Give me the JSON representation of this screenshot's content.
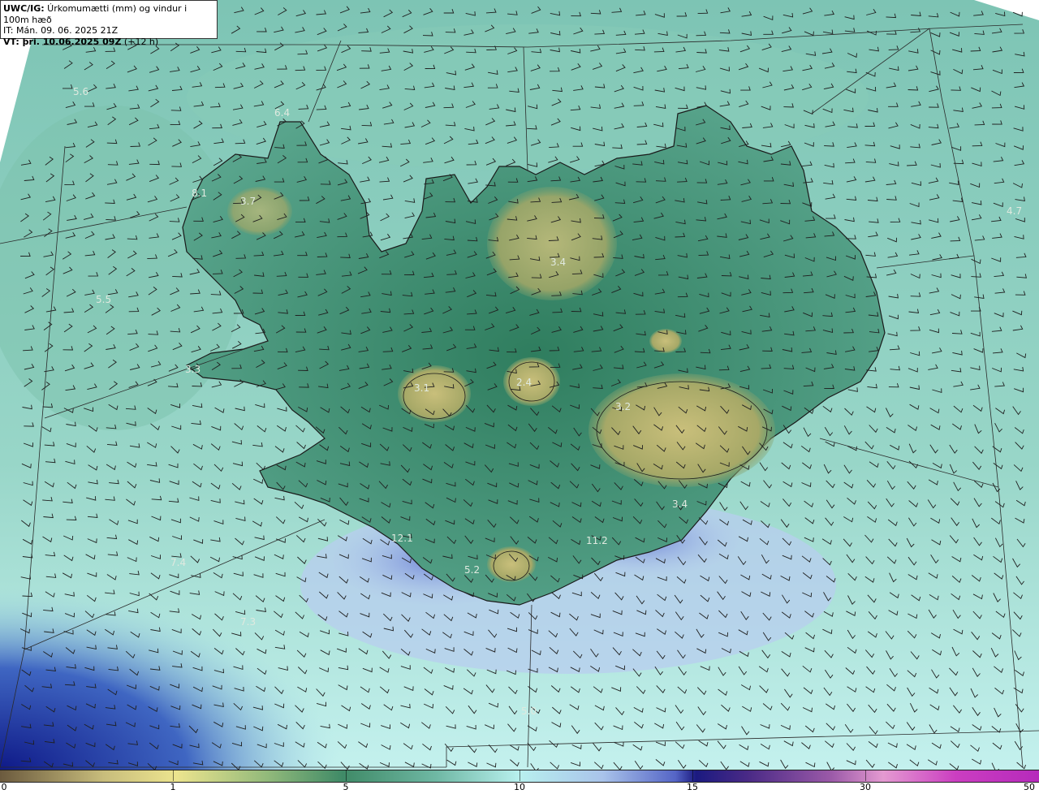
{
  "header": {
    "line1_bold": "UWC/IG:",
    "line1_rest": " Úrkomumætti (mm) og vindur i 100m hæð",
    "line2": "IT: Mán. 09. 06. 2025 21Z",
    "line3_bold": "VT: þri. 10.06.2025 09Z",
    "line3_rest": " (+12 h)"
  },
  "colors": {
    "sea_shallow": "#bfeee8",
    "sea_green": "#76c0ae",
    "land_green": "#3f8a67",
    "highland": "#b7b070",
    "rain_blue": "#8fa6e0",
    "deep_blue": "#1b2a9a",
    "coast": "#1a1a1a",
    "barb": "#1f1f1f"
  },
  "map_labels": [
    {
      "text": "5.6"
    },
    {
      "text": "6.4"
    },
    {
      "text": "8.1"
    },
    {
      "text": "3.7"
    },
    {
      "text": "5.5"
    },
    {
      "text": "3.4"
    },
    {
      "text": "3.3"
    },
    {
      "text": "3.1"
    },
    {
      "text": "2.4"
    },
    {
      "text": "3.2"
    },
    {
      "text": "3.4"
    },
    {
      "text": "12.1"
    },
    {
      "text": "11.2"
    },
    {
      "text": "5.2"
    },
    {
      "text": "7.4"
    },
    {
      "text": "7.3"
    },
    {
      "text": "5.0"
    },
    {
      "text": "4.7"
    }
  ],
  "legend": {
    "ticks": [
      "0",
      "1",
      "5",
      "10",
      "15",
      "30",
      "50"
    ]
  }
}
